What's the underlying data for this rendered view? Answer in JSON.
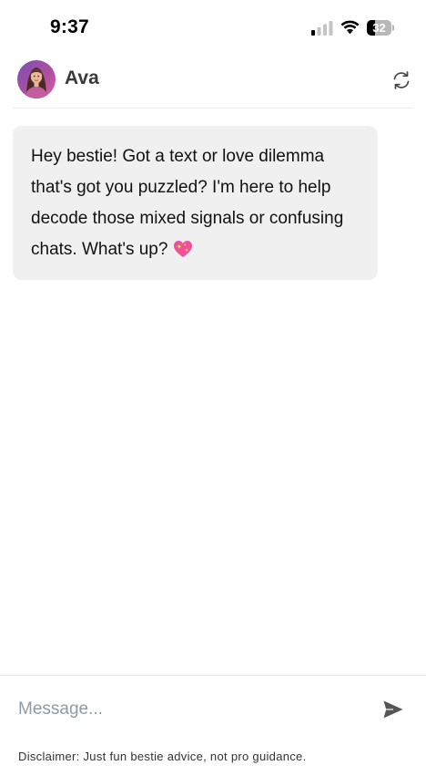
{
  "status_bar": {
    "time": "9:37",
    "battery_percent": "32",
    "battery_level": 0.32,
    "cellular_bars": 1,
    "cellular_icon": "cellular-signal-icon",
    "wifi_icon": "wifi-icon"
  },
  "header": {
    "name": "Ava",
    "avatar_icon": "avatar",
    "refresh_icon": "refresh-icon"
  },
  "messages": [
    {
      "sender": "Ava",
      "text": "Hey bestie! Got a text or love dilemma that's got you puzzled? I'm here to help decode those mixed signals or confusing chats. What's up?",
      "emoji_icon": "sparkling-heart-icon",
      "bubble_color": "#f0f0f0"
    }
  ],
  "composer": {
    "placeholder": "Message...",
    "value": "",
    "send_icon": "send-icon",
    "disclaimer": "Disclaimer: Just fun bestie advice, not pro guidance."
  },
  "colors": {
    "background": "#ffffff",
    "bubble": "#f0f0f0",
    "placeholder": "#8e9aa6",
    "icon": "#444444"
  }
}
